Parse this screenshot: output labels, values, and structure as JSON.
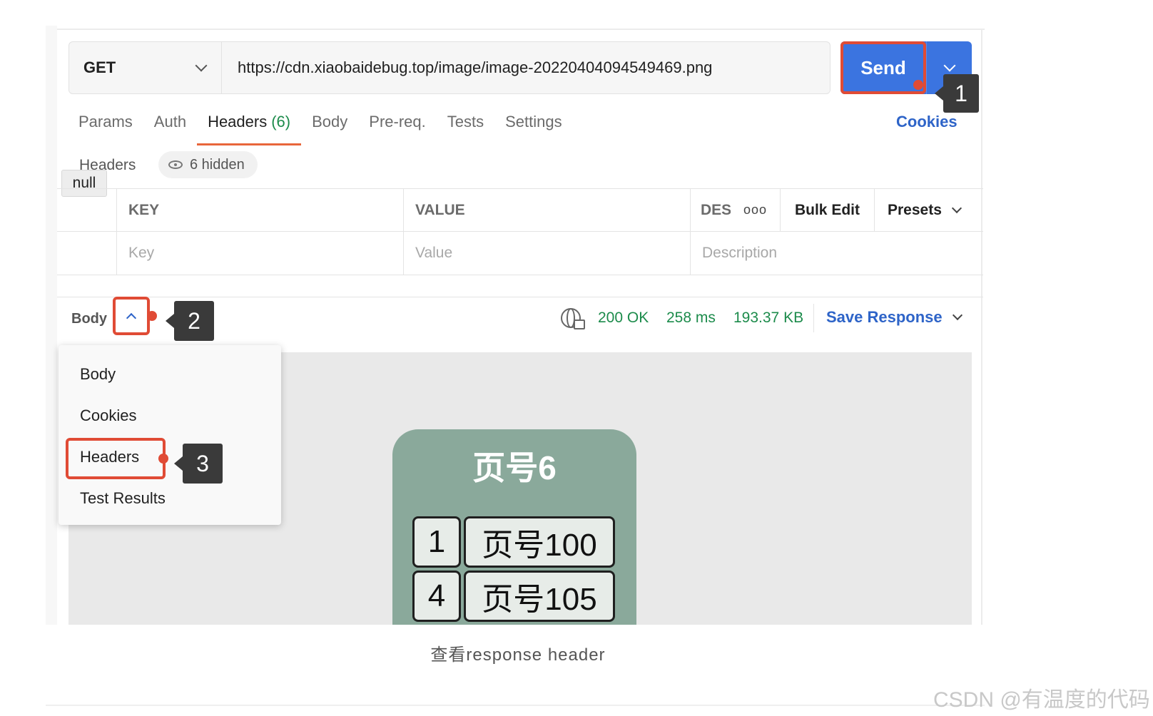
{
  "request": {
    "method": "GET",
    "url": "https://cdn.xiaobaidebug.top/image/image-20220404094549469.png",
    "send_label": "Send"
  },
  "tabs": [
    {
      "label": "Params"
    },
    {
      "label": "Auth"
    },
    {
      "label": "Headers",
      "count": "(6)",
      "active": true
    },
    {
      "label": "Body"
    },
    {
      "label": "Pre-req."
    },
    {
      "label": "Tests"
    },
    {
      "label": "Settings"
    }
  ],
  "cookies_link": "Cookies",
  "headers_section": {
    "label": "Headers",
    "hidden_text": "6 hidden",
    "tooltip": "null"
  },
  "table": {
    "columns": [
      "KEY",
      "VALUE",
      "DES"
    ],
    "bulk_edit": "Bulk Edit",
    "presets": "Presets",
    "more": "ooo",
    "placeholders": {
      "key": "Key",
      "value": "Value",
      "description": "Description"
    }
  },
  "response": {
    "body_label": "Body",
    "status": "200 OK",
    "time": "258 ms",
    "size": "193.37 KB",
    "save_response": "Save Response"
  },
  "menu_items": [
    "Body",
    "Cookies",
    "Headers",
    "Test Results"
  ],
  "callouts": [
    "1",
    "2",
    "3"
  ],
  "preview_image": {
    "title": "页号6",
    "cells": [
      "1",
      "页号100",
      "4",
      "页号105"
    ],
    "bg_color": "#8aa99b"
  },
  "caption": "查看response header",
  "watermark": "CSDN @有温度的代码",
  "colors": {
    "send_blue": "#3b74e0",
    "highlight_red": "#e04b35",
    "status_green": "#1c8b4b",
    "link_blue": "#2e64c8",
    "tab_underline": "#e8663b"
  }
}
